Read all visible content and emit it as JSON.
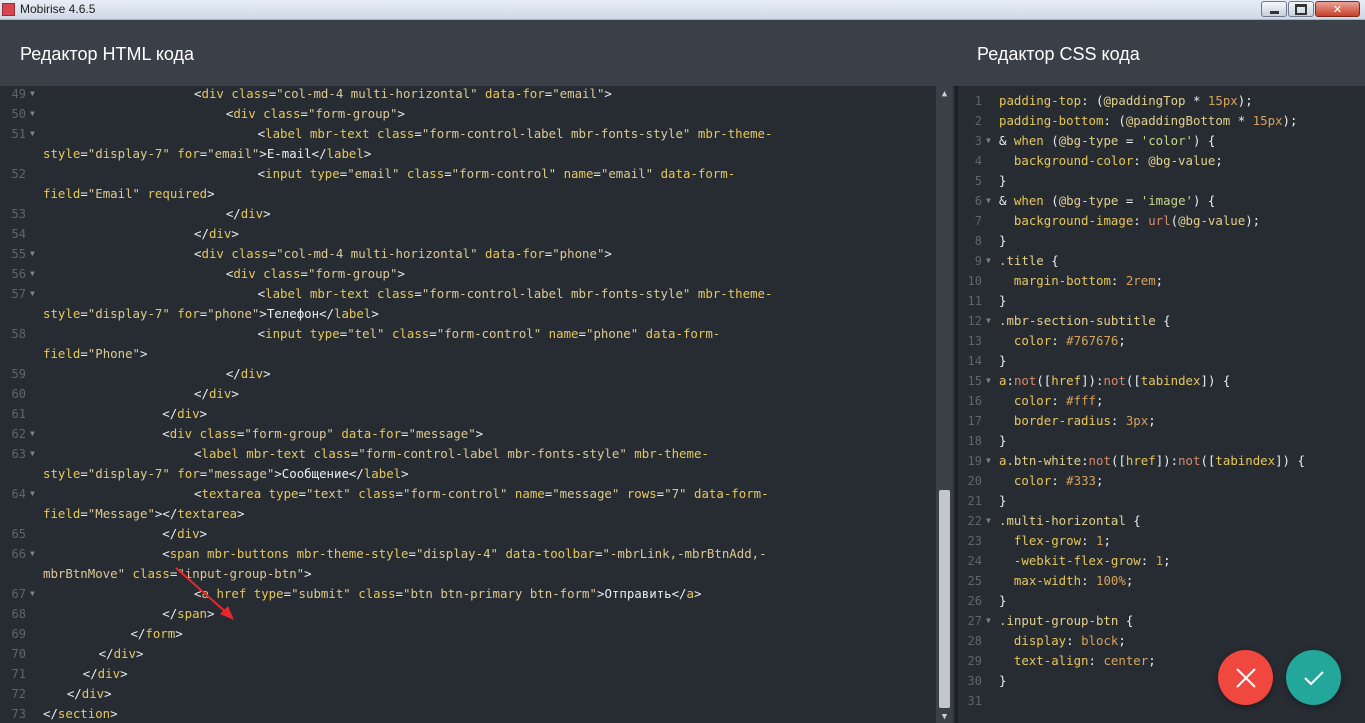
{
  "window": {
    "title": "Mobirise 4.6.5"
  },
  "header": {
    "html_title": "Редактор HTML кода",
    "css_title": "Редактор CSS кода"
  },
  "html_editor": {
    "lines": [
      {
        "n": "49",
        "fold": true,
        "indent": 19,
        "html": "<span class='p'>&lt;</span><span class='t'>div</span> <span class='a'>class</span>=<span class='s'>\"col-md-4 multi-horizontal\"</span> <span class='a'>data-for</span>=<span class='s'>\"email\"</span>&gt;"
      },
      {
        "n": "50",
        "fold": true,
        "indent": 23,
        "html": "&lt;<span class='t'>div</span> <span class='a'>class</span>=<span class='s'>\"form-group\"</span>&gt;"
      },
      {
        "n": "51",
        "fold": true,
        "indent": 27,
        "html": "&lt;<span class='t'>label</span> <span class='a'>mbr-text</span> <span class='a'>class</span>=<span class='s'>\"form-control-label mbr-fonts-style\"</span> <span class='a'>mbr-theme-</span>"
      },
      {
        "n": "",
        "fold": false,
        "indent": 0,
        "html": "<span class='a'>style</span>=<span class='s'>\"display-7\"</span> <span class='a'>for</span>=<span class='s'>\"email\"</span>&gt;E-mail&lt;/<span class='t'>label</span>&gt;"
      },
      {
        "n": "52",
        "fold": false,
        "indent": 27,
        "html": "&lt;<span class='t'>input</span> <span class='a'>type</span>=<span class='s'>\"email\"</span> <span class='a'>class</span>=<span class='s'>\"form-control\"</span> <span class='a'>name</span>=<span class='s'>\"email\"</span> <span class='a'>data-form-</span>"
      },
      {
        "n": "",
        "fold": false,
        "indent": 0,
        "html": "<span class='a'>field</span>=<span class='s'>\"Email\"</span> <span class='a'>required</span>&gt;"
      },
      {
        "n": "53",
        "fold": false,
        "indent": 23,
        "html": "&lt;/<span class='t'>div</span>&gt;"
      },
      {
        "n": "54",
        "fold": false,
        "indent": 19,
        "html": "&lt;/<span class='t'>div</span>&gt;"
      },
      {
        "n": "55",
        "fold": true,
        "indent": 19,
        "html": "&lt;<span class='t'>div</span> <span class='a'>class</span>=<span class='s'>\"col-md-4 multi-horizontal\"</span> <span class='a'>data-for</span>=<span class='s'>\"phone\"</span>&gt;"
      },
      {
        "n": "56",
        "fold": true,
        "indent": 23,
        "html": "&lt;<span class='t'>div</span> <span class='a'>class</span>=<span class='s'>\"form-group\"</span>&gt;"
      },
      {
        "n": "57",
        "fold": true,
        "indent": 27,
        "html": "&lt;<span class='t'>label</span> <span class='a'>mbr-text</span> <span class='a'>class</span>=<span class='s'>\"form-control-label mbr-fonts-style\"</span> <span class='a'>mbr-theme-</span>"
      },
      {
        "n": "",
        "fold": false,
        "indent": 0,
        "html": "<span class='a'>style</span>=<span class='s'>\"display-7\"</span> <span class='a'>for</span>=<span class='s'>\"phone\"</span>&gt;Телефон&lt;/<span class='t'>label</span>&gt;"
      },
      {
        "n": "58",
        "fold": false,
        "indent": 27,
        "html": "&lt;<span class='t'>input</span> <span class='a'>type</span>=<span class='s'>\"tel\"</span> <span class='a'>class</span>=<span class='s'>\"form-control\"</span> <span class='a'>name</span>=<span class='s'>\"phone\"</span> <span class='a'>data-form-</span>"
      },
      {
        "n": "",
        "fold": false,
        "indent": 0,
        "html": "<span class='a'>field</span>=<span class='s'>\"Phone\"</span>&gt;"
      },
      {
        "n": "59",
        "fold": false,
        "indent": 23,
        "html": "&lt;/<span class='t'>div</span>&gt;"
      },
      {
        "n": "60",
        "fold": false,
        "indent": 19,
        "html": "&lt;/<span class='t'>div</span>&gt;"
      },
      {
        "n": "61",
        "fold": false,
        "indent": 15,
        "html": "&lt;/<span class='t'>div</span>&gt;"
      },
      {
        "n": "62",
        "fold": true,
        "indent": 15,
        "html": "&lt;<span class='t'>div</span> <span class='a'>class</span>=<span class='s'>\"form-group\"</span> <span class='a'>data-for</span>=<span class='s'>\"message\"</span>&gt;"
      },
      {
        "n": "63",
        "fold": true,
        "indent": 19,
        "html": "&lt;<span class='t'>label</span> <span class='a'>mbr-text</span> <span class='a'>class</span>=<span class='s'>\"form-control-label mbr-fonts-style\"</span> <span class='a'>mbr-theme-</span>"
      },
      {
        "n": "",
        "fold": false,
        "indent": 0,
        "html": "<span class='a'>style</span>=<span class='s'>\"display-7\"</span> <span class='a'>for</span>=<span class='s'>\"message\"</span>&gt;Сообщение&lt;/<span class='t'>label</span>&gt;"
      },
      {
        "n": "64",
        "fold": true,
        "indent": 19,
        "html": "&lt;<span class='t'>textarea</span> <span class='a'>type</span>=<span class='s'>\"text\"</span> <span class='a'>class</span>=<span class='s'>\"form-control\"</span> <span class='a'>name</span>=<span class='s'>\"message\"</span> <span class='a'>rows</span>=<span class='s'>\"7\"</span> <span class='a'>data-form-</span>"
      },
      {
        "n": "",
        "fold": false,
        "indent": 0,
        "html": "<span class='a'>field</span>=<span class='s'>\"Message\"</span>&gt;&lt;/<span class='t'>textarea</span>&gt;"
      },
      {
        "n": "65",
        "fold": false,
        "indent": 15,
        "html": "&lt;/<span class='t'>div</span>&gt;"
      },
      {
        "n": "66",
        "fold": true,
        "indent": 15,
        "html": "&lt;<span class='t'>span</span> <span class='a'>mbr-buttons</span> <span class='a'>mbr-theme-style</span>=<span class='s'>\"display-4\"</span> <span class='a'>data-toolbar</span>=<span class='s'>\"-mbrLink,-mbrBtnAdd,-</span>"
      },
      {
        "n": "",
        "fold": false,
        "indent": 0,
        "html": "<span class='s'>mbrBtnMove\"</span> <span class='a'>class</span>=<span class='s'>\"input-group-btn\"</span>&gt;"
      },
      {
        "n": "67",
        "fold": true,
        "indent": 19,
        "html": "&lt;<span class='t'>a</span> <span class='a'>href</span> <span class='a'>type</span>=<span class='s'>\"submit\"</span> <span class='a'>class</span>=<span class='s'>\"btn btn-primary btn-form\"</span>&gt;Отправить&lt;/<span class='t'>a</span>&gt;"
      },
      {
        "n": "68",
        "fold": false,
        "indent": 15,
        "html": "&lt;/<span class='t'>span</span>&gt;"
      },
      {
        "n": "69",
        "fold": false,
        "indent": 11,
        "html": "&lt;/<span class='t'>form</span>&gt;"
      },
      {
        "n": "70",
        "fold": false,
        "indent": 7,
        "html": "&lt;/<span class='t'>div</span>&gt;"
      },
      {
        "n": "71",
        "fold": false,
        "indent": 5,
        "html": "&lt;/<span class='t'>div</span>&gt;"
      },
      {
        "n": "72",
        "fold": false,
        "indent": 3,
        "html": "&lt;/<span class='t'>div</span>&gt;"
      },
      {
        "n": "73",
        "fold": false,
        "indent": 0,
        "html": "&lt;/<span class='t'>section</span>&gt;"
      }
    ]
  },
  "css_editor": {
    "lines": [
      {
        "n": "1",
        "fold": false,
        "html": "<span class='ck'>padding-top</span>: (<span class='cv'>@paddingTop</span> * <span class='cn'>15px</span>);"
      },
      {
        "n": "2",
        "fold": false,
        "html": "<span class='ck'>padding-bottom</span>: (<span class='cv'>@paddingBottom</span> * <span class='cn'>15px</span>);"
      },
      {
        "n": "3",
        "fold": true,
        "html": "&amp; <span class='ck'>when</span> (<span class='cv'>@bg-type</span> = <span class='cs'>'color'</span>) {"
      },
      {
        "n": "4",
        "fold": false,
        "html": "  <span class='ck'>background-color</span>: <span class='cv'>@bg-value</span>;"
      },
      {
        "n": "5",
        "fold": false,
        "html": "}"
      },
      {
        "n": "6",
        "fold": true,
        "html": "&amp; <span class='ck'>when</span> (<span class='cv'>@bg-type</span> = <span class='cs'>'image'</span>) {"
      },
      {
        "n": "7",
        "fold": false,
        "html": "  <span class='ck'>background-image</span>: <span class='cf'>url</span>(<span class='cv'>@bg-value</span>);"
      },
      {
        "n": "8",
        "fold": false,
        "html": "}"
      },
      {
        "n": "9",
        "fold": true,
        "html": "<span class='cv'>.title</span> {"
      },
      {
        "n": "10",
        "fold": false,
        "html": "  <span class='ck'>margin-bottom</span>: <span class='cn'>2rem</span>;"
      },
      {
        "n": "11",
        "fold": false,
        "html": "}"
      },
      {
        "n": "12",
        "fold": true,
        "html": "<span class='cv'>.mbr-section-subtitle</span> {"
      },
      {
        "n": "13",
        "fold": false,
        "html": "  <span class='ck'>color</span>: <span class='cn'>#767676</span>;"
      },
      {
        "n": "14",
        "fold": false,
        "html": "}"
      },
      {
        "n": "15",
        "fold": true,
        "html": "<span class='ck'>a</span>:<span class='cf'>not</span>([<span class='ck'>href</span>]):<span class='cf'>not</span>([<span class='ck'>tabindex</span>]) {"
      },
      {
        "n": "16",
        "fold": false,
        "html": "  <span class='ck'>color</span>: <span class='cn'>#fff</span>;"
      },
      {
        "n": "17",
        "fold": false,
        "html": "  <span class='ck'>border-radius</span>: <span class='cn'>3px</span>;"
      },
      {
        "n": "18",
        "fold": false,
        "html": "}"
      },
      {
        "n": "19",
        "fold": true,
        "html": "<span class='ck'>a</span><span class='cv'>.btn-white</span>:<span class='cf'>not</span>([<span class='ck'>href</span>]):<span class='cf'>not</span>([<span class='ck'>tabindex</span>]) {"
      },
      {
        "n": "20",
        "fold": false,
        "html": "  <span class='ck'>color</span>: <span class='cn'>#333</span>;"
      },
      {
        "n": "21",
        "fold": false,
        "html": "}"
      },
      {
        "n": "22",
        "fold": true,
        "html": "<span class='cv'>.multi-horizontal</span> {"
      },
      {
        "n": "23",
        "fold": false,
        "html": "  <span class='ck'>flex-grow</span>: <span class='cn'>1</span>;"
      },
      {
        "n": "24",
        "fold": false,
        "html": "  <span class='ck'>-webkit-flex-grow</span>: <span class='cn'>1</span>;"
      },
      {
        "n": "25",
        "fold": false,
        "html": "  <span class='ck'>max-width</span>: <span class='cn'>100%</span>;"
      },
      {
        "n": "26",
        "fold": false,
        "html": "}"
      },
      {
        "n": "27",
        "fold": true,
        "html": "<span class='cv'>.input-group-btn</span> {"
      },
      {
        "n": "28",
        "fold": false,
        "html": "  <span class='ck'>display</span>: <span class='cn'>block</span>;"
      },
      {
        "n": "29",
        "fold": false,
        "html": "  <span class='ck'>text-align</span>: <span class='cn'>center</span>;"
      },
      {
        "n": "30",
        "fold": false,
        "html": "}"
      },
      {
        "n": "31",
        "fold": false,
        "html": ""
      }
    ]
  },
  "buttons": {
    "cancel": "cancel",
    "confirm": "confirm"
  },
  "colors": {
    "header_bg": "#3a4047",
    "editor_bg": "#272c33",
    "cancel": "#f0473f",
    "confirm": "#23a79a",
    "annotation_arrow": "#e8262b"
  }
}
